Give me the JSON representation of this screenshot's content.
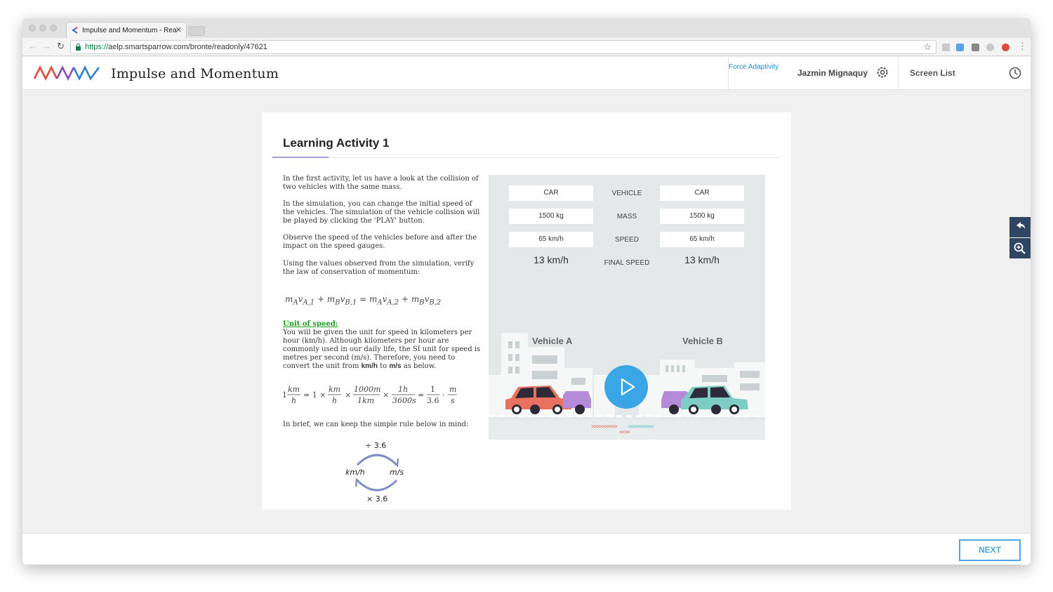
{
  "browser": {
    "tab_title": "Impulse and Momentum - Rea",
    "url_scheme": "https://",
    "url_rest": "aelp.smartsparrow.com/bronte/readonly/47621"
  },
  "app": {
    "title": "Impulse and Momentum",
    "force_adaptivity": "Force Adaptivity",
    "user_name": "Jazmin Mignaquy",
    "screen_list": "Screen List"
  },
  "activity": {
    "title": "Learning Activity 1",
    "p1": "In the first activity, let us have a look at the collision of two vehicles with the same mass.",
    "p2": "In the simulation, you can change the initial speed of the vehicles. The simulation of the vehicle collision will be played by clicking the 'PLAY' button.",
    "p3": "Observe the speed of the vehicles before and after the impact on the speed gauges.",
    "p4": "Using the values observed from the simulation, verify the law of conservation of momentum:",
    "unit_heading": "Unit of speed:",
    "unit_text_pre": "You will be given the unit for speed in kilometers per hour (km/h). Although kilometers per hour are commonly used in our daily life, the SI unit for speed is metres per second (m/s). Therefore, you need to convert the unit from ",
    "unit_kmh": "km/h",
    "unit_to": " to ",
    "unit_ms": "m/s",
    "unit_end": " as below.",
    "brief": "In brief, we can keep the simple rule below in mind:",
    "cycle_div": "÷ 3.6",
    "cycle_mul": "× 3.6",
    "cycle_kmh": "km/h",
    "cycle_ms": "m/s"
  },
  "simulation": {
    "row_vehicle": {
      "left": "CAR",
      "label": "VEHICLE",
      "right": "CAR"
    },
    "row_mass": {
      "left": "1500 kg",
      "label": "MASS",
      "right": "1500 kg"
    },
    "row_speed": {
      "left": "65 km/h",
      "label": "SPEED",
      "right": "65 km/h"
    },
    "row_final": {
      "left": "13 km/h",
      "label": "FINAL SPEED",
      "right": "13 km/h"
    },
    "vehicle_a": "Vehicle A",
    "vehicle_b": "Vehicle B",
    "arrows_right": ">>>>>>>>>>",
    "arrows_left": "<<<<<<<<<<",
    "arrows_center": "<<>>"
  },
  "footer": {
    "next": "NEXT"
  },
  "colors": {
    "accent": "#4aa8e2",
    "link": "#1a8fd8",
    "unit_heading": "#1a9c1a",
    "play": "#3aa6e6",
    "car_a": "#e8715f",
    "car_b": "#7ecdc4",
    "car_purple": "#b58ad9"
  }
}
